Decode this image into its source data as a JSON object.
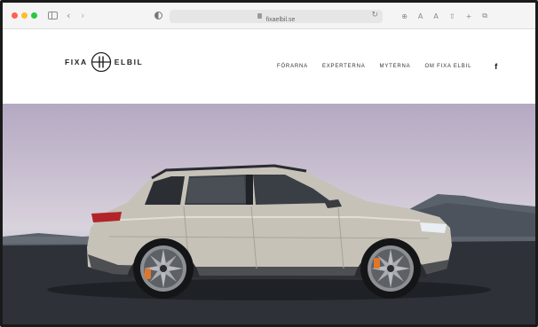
{
  "browser": {
    "url": "fixaelbil.se",
    "icons": {
      "sidebar": "sidebar-icon",
      "back": "‹",
      "forward": "›",
      "reload": "↻",
      "tracker": "shield-icon",
      "download": "⊕",
      "text_small": "A",
      "text_large": "A",
      "share": "⇧",
      "new_tab": "+",
      "tabs": "⧉"
    }
  },
  "site": {
    "logo_left": "FIXA",
    "logo_right": "ELBIL",
    "nav": [
      {
        "label": "FÖRARNA"
      },
      {
        "label": "EXPERTERNA"
      },
      {
        "label": "MYTERNA"
      },
      {
        "label": "OM FIXA ELBIL"
      }
    ],
    "social_icon": "f"
  },
  "colors": {
    "traffic_red": "#ff5f57",
    "traffic_yellow": "#febc2e",
    "traffic_green": "#28c840",
    "brand_dark": "#1f1f1f"
  }
}
